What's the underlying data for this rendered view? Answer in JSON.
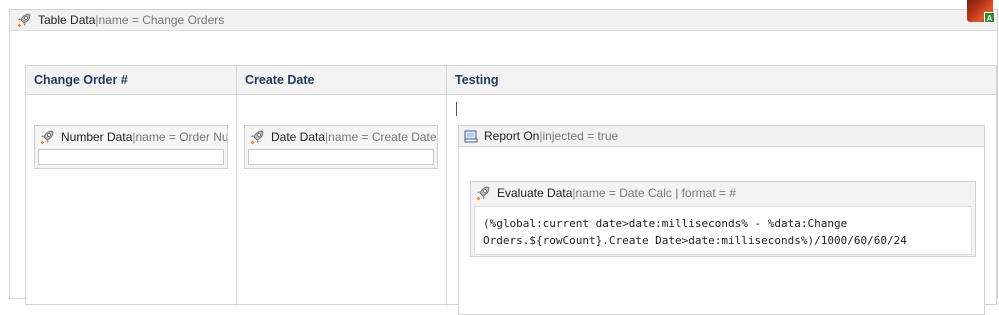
{
  "outer": {
    "type_label": "Table Data",
    "separator": " | ",
    "meta": "name = Change Orders",
    "icon": "rocket-icon"
  },
  "avatar": {
    "badge": "A"
  },
  "table": {
    "columns": [
      "Change Order #",
      "Create Date",
      "Testing"
    ]
  },
  "cells": {
    "number_data": {
      "type_label": "Number Data",
      "separator": " | ",
      "meta": "name = Order Number"
    },
    "date_data": {
      "type_label": "Date Data",
      "separator": " | ",
      "meta": "name = Create Date | format"
    }
  },
  "report": {
    "type_label": "Report On",
    "separator": " | ",
    "meta": "injected = true",
    "icon": "book-icon",
    "evaluate": {
      "type_label": "Evaluate Data",
      "separator": " | ",
      "meta": "name = Date Calc | format = #",
      "expression_line1": "(%global:current date>date:milliseconds% - %data:Change",
      "expression_line2": "Orders.${rowCount}.Create Date>date:milliseconds%)/1000/60/60/24"
    }
  }
}
